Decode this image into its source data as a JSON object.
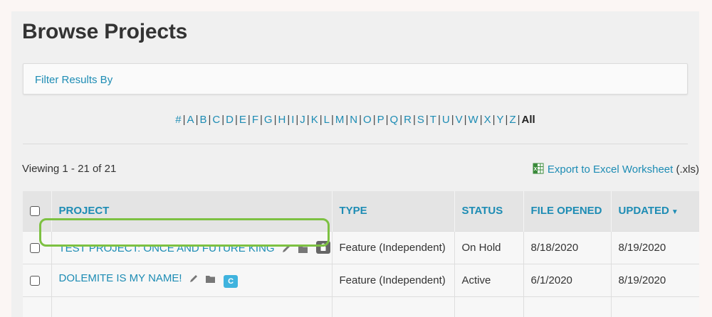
{
  "page": {
    "title": "Browse Projects"
  },
  "filter": {
    "label": "Filter Results By"
  },
  "alphabet": {
    "letters": [
      "#",
      "A",
      "B",
      "C",
      "D",
      "E",
      "F",
      "G",
      "H",
      "I",
      "J",
      "K",
      "L",
      "M",
      "N",
      "O",
      "P",
      "Q",
      "R",
      "S",
      "T",
      "U",
      "V",
      "W",
      "X",
      "Y",
      "Z"
    ],
    "active": "All"
  },
  "results": {
    "viewing": "Viewing 1 - 21 of 21",
    "export_label": "Export to Excel Worksheet",
    "export_suffix": " (.xls)"
  },
  "table": {
    "headers": {
      "project": "PROJECT",
      "type": "TYPE",
      "status": "STATUS",
      "file_opened": "FILE OPENED",
      "updated": "UPDATED",
      "updated_sort_icon": "caret-down-icon"
    },
    "rows": [
      {
        "project": "TEST PROJECT: ONCE AND FUTURE KING",
        "type": "Feature (Independent)",
        "status": "On Hold",
        "file_opened": "8/18/2020",
        "updated": "8/19/2020",
        "badge": "lock"
      },
      {
        "project": "DOLEMITE IS MY NAME!",
        "type": "Feature (Independent)",
        "status": "Active",
        "file_opened": "6/1/2020",
        "updated": "8/19/2020",
        "badge": "C"
      }
    ]
  },
  "colors": {
    "link": "#1d8cb4",
    "highlight": "#7dc142",
    "badge_c": "#3fb3de",
    "badge_lock": "#666666"
  }
}
